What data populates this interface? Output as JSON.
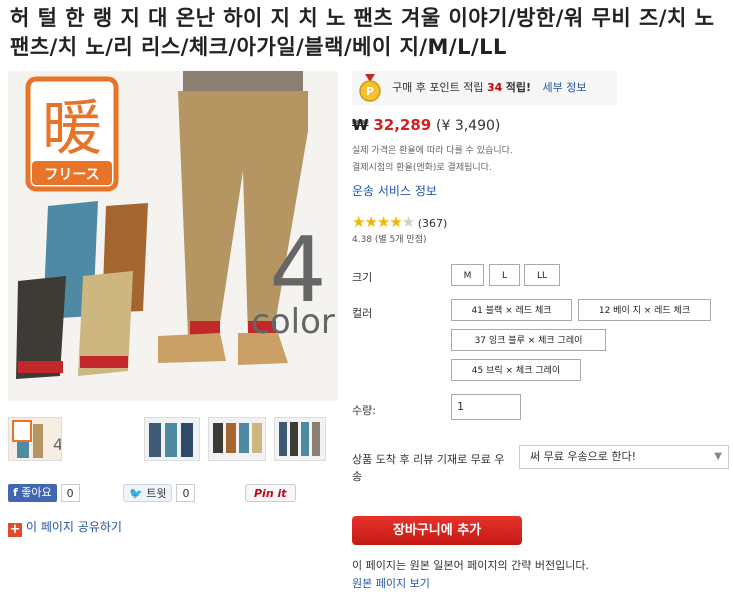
{
  "product": {
    "title": "허 털 한 랭 지 대 온난 하이 지 치 노 팬츠 겨울 이야기/방한/워 무비 즈/치 노 팬츠/치 노/리 리스/체크/아가일/블랙/베이 지/M/L/LL"
  },
  "image": {
    "badge_char": "暖",
    "badge_sub": "フリース",
    "big_number": "4",
    "big_word": "color",
    "small_caption": "It proposes the item of cool and standard in season."
  },
  "social": {
    "fb_label": "좋아요",
    "fb_count": "0",
    "tw_label": "트윗",
    "tw_count": "0",
    "pin_label": "Pin it",
    "share_label": "이 페이지 공유하기"
  },
  "points": {
    "prefix": "구매 후 포인트 적립",
    "value": "34",
    "suffix": "적립!",
    "link": "세부 정보"
  },
  "price": {
    "symbol": "₩",
    "won": "32,289",
    "yen": "(¥ 3,490)",
    "note1": "실제 가격은 환율에 따라 다를 수 있습니다.",
    "note2": "결제시점의 환율(엔화)로 결제됩니다."
  },
  "shipping_link": "운송 서비스 정보",
  "rating": {
    "stars": "★★★★",
    "half": "★",
    "count": "(367)",
    "sub": "4.38 (별 5개 만점)"
  },
  "size": {
    "label": "크기",
    "options": [
      "M",
      "L",
      "LL"
    ]
  },
  "color": {
    "label": "컬러",
    "options": [
      "41 블랙 × 레드 체크",
      "12 베이 지 × 레드 체크",
      "37 잉크 블루 × 체크 그레이",
      "45 브릭 × 체크 그레이"
    ]
  },
  "quantity": {
    "label": "수량:",
    "value": "1"
  },
  "review": {
    "label": "상품 도착 후 리뷰 기재로 무료 우송",
    "selected": "써 무료 우송으로 한다!"
  },
  "cart_button": "장바구니에 추가",
  "footer": {
    "note": "이 페이지는 원본 일본어 페이지의 간략 버전입니다.",
    "link": "원본 페이지 보기"
  }
}
